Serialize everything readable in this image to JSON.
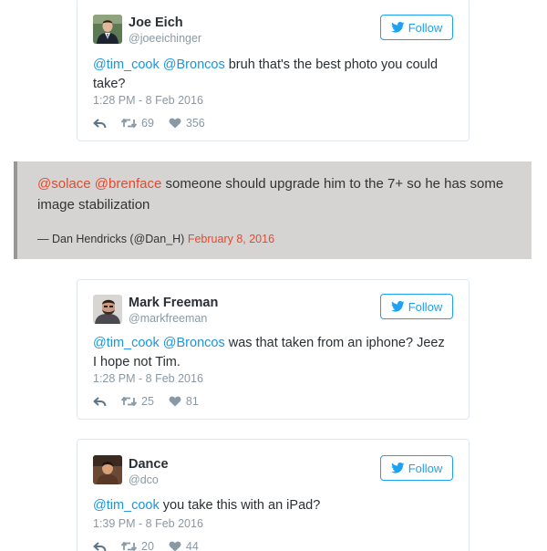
{
  "tweets": [
    {
      "name": "Joe Eich",
      "handle": "@joeeichinger",
      "follow_label": "Follow",
      "text": {
        "mention1": "@tim_cook",
        "mention2": "@Broncos",
        "body": " bruh that's the best photo you could take?"
      },
      "timestamp": "1:28 PM - 8 Feb 2016",
      "retweets": "69",
      "likes": "356",
      "avatar_icon": "man-in-suit-avatar"
    },
    {
      "name": "Mark Freeman",
      "handle": "@markfreeman",
      "follow_label": "Follow",
      "text": {
        "mention1": "@tim_cook",
        "mention2": "@Broncos",
        "body": " was that taken from an iphone? Jeez I hope not Tim."
      },
      "timestamp": "1:28 PM - 8 Feb 2016",
      "retweets": "25",
      "likes": "81",
      "avatar_icon": "bearded-man-avatar"
    },
    {
      "name": "Dance",
      "handle": "@dco",
      "follow_label": "Follow",
      "text": {
        "mention1": "@tim_cook",
        "body": " you take this with an iPad?"
      },
      "timestamp": "1:39 PM - 8 Feb 2016",
      "retweets": "20",
      "likes": "44",
      "avatar_icon": "person-avatar"
    }
  ],
  "quote": {
    "mention1": "@solace",
    "mention2": "@brenface",
    "body": " someone should upgrade him to the 7+ so he has some image stabilization",
    "author": "— Dan Hendricks (@Dan_H)",
    "date": "February 8, 2016"
  },
  "colors": {
    "twitter_blue": "#1da1f2",
    "mention_blue": "#1b95e0",
    "quote_accent": "#e8492b",
    "quote_bg": "#d6d3d3"
  },
  "icons": [
    "twitter-bird-icon",
    "reply-icon",
    "retweet-icon",
    "heart-icon"
  ]
}
